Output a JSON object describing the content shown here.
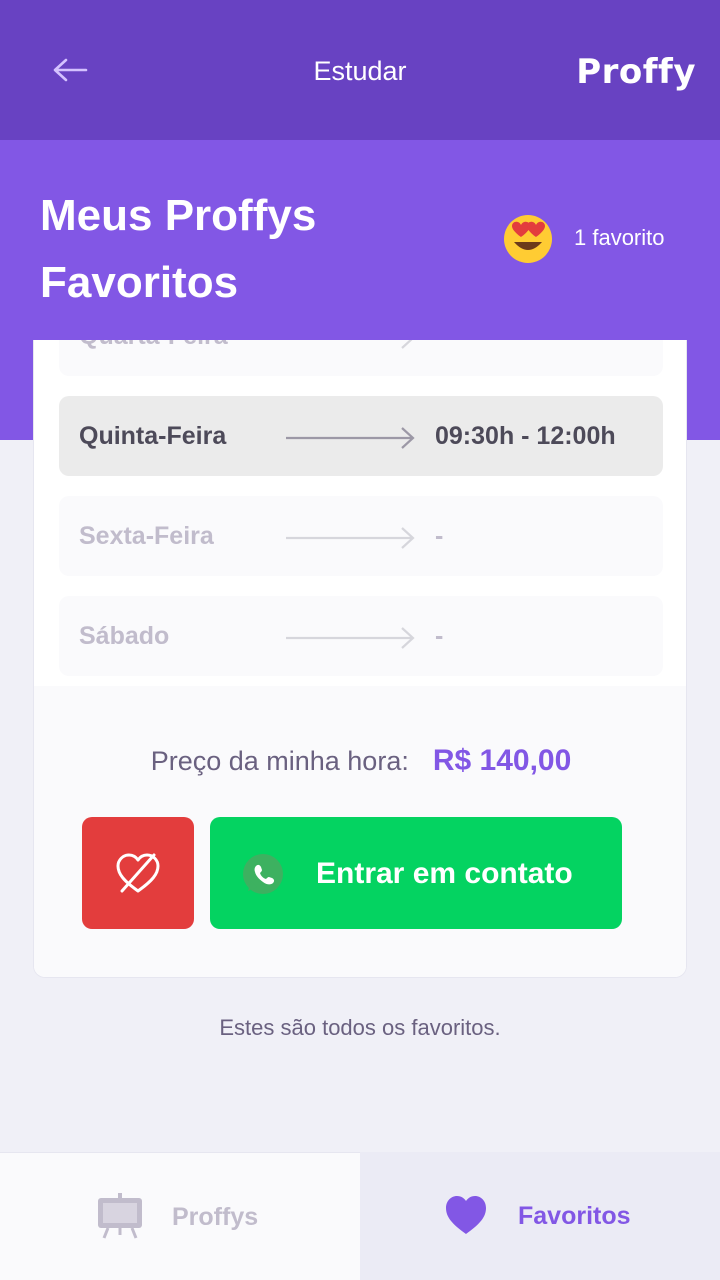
{
  "topbar": {
    "title": "Estudar",
    "logo": "Proffy",
    "back_icon": "arrow-left-icon"
  },
  "header": {
    "title_line1": "Meus Proffys",
    "title_line2": "Favoritos",
    "favorite_count_text": "1 favorito",
    "favorite_count_icon": "heart-eyes-emoji-icon"
  },
  "schedule": [
    {
      "day": "Quarta-Feira",
      "time": "-",
      "active": false
    },
    {
      "day": "Quinta-Feira",
      "time": "09:30h - 12:00h",
      "active": true
    },
    {
      "day": "Sexta-Feira",
      "time": "-",
      "active": false
    },
    {
      "day": "Sábado",
      "time": "-",
      "active": false
    }
  ],
  "card_footer": {
    "price_label": "Preço da minha hora:",
    "price_value": "R$ 140,00",
    "unfavorite_icon": "heart-outline-icon",
    "contact_label": "Entrar em contato",
    "contact_icon": "whatsapp-icon"
  },
  "end_message": "Estes são todos os favoritos.",
  "tabbar": {
    "tab1_label": "Proffys",
    "tab1_icon": "easel-icon",
    "tab2_label": "Favoritos",
    "tab2_icon": "heart-icon"
  },
  "colors": {
    "primary": "#8257E5",
    "primary_dark": "#6842C2",
    "danger": "#E33D3D",
    "whatsapp_green": "#04D361"
  }
}
